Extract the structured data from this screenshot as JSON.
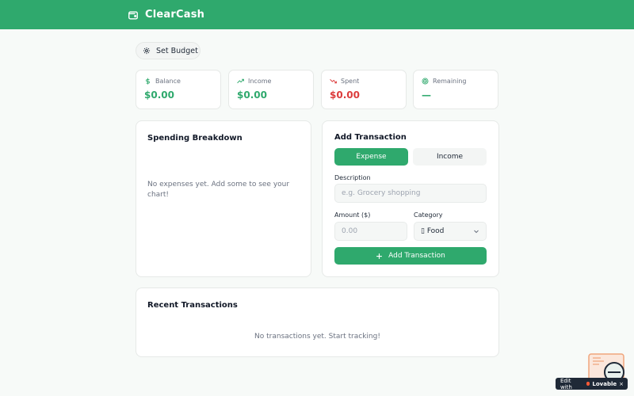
{
  "app": {
    "title": "ClearCash"
  },
  "toolbar": {
    "set_budget_label": "Set Budget"
  },
  "stats": [
    {
      "label": "Balance",
      "value": "$0.00",
      "icon": "dollar-icon",
      "color": "#2fa96d"
    },
    {
      "label": "Income",
      "value": "$0.00",
      "icon": "trending-up-icon",
      "color": "#2fa96d"
    },
    {
      "label": "Spent",
      "value": "$0.00",
      "icon": "trending-down-icon",
      "color": "#dc3c3c"
    },
    {
      "label": "Remaining",
      "value": "—",
      "icon": "target-icon",
      "color": "#2fa96d"
    }
  ],
  "breakdown": {
    "title": "Spending Breakdown",
    "empty_text": "No expenses yet. Add some to see your chart!"
  },
  "add_transaction": {
    "title": "Add Transaction",
    "tabs": {
      "expense": "Expense",
      "income": "Income",
      "active": "Expense"
    },
    "description_label": "Description",
    "description_placeholder": "e.g. Grocery shopping",
    "amount_label": "Amount ($)",
    "amount_placeholder": "0.00",
    "category_label": "Category",
    "category_value": "▯ Food",
    "submit_label": "Add Transaction"
  },
  "recent": {
    "title": "Recent Transactions",
    "empty_text": "No transactions yet. Start tracking!"
  },
  "badge": {
    "prefix": "Edit with",
    "brand": "Lovable",
    "close": "×"
  },
  "colors": {
    "accent": "#2fa96d",
    "danger": "#dc3c3c"
  }
}
